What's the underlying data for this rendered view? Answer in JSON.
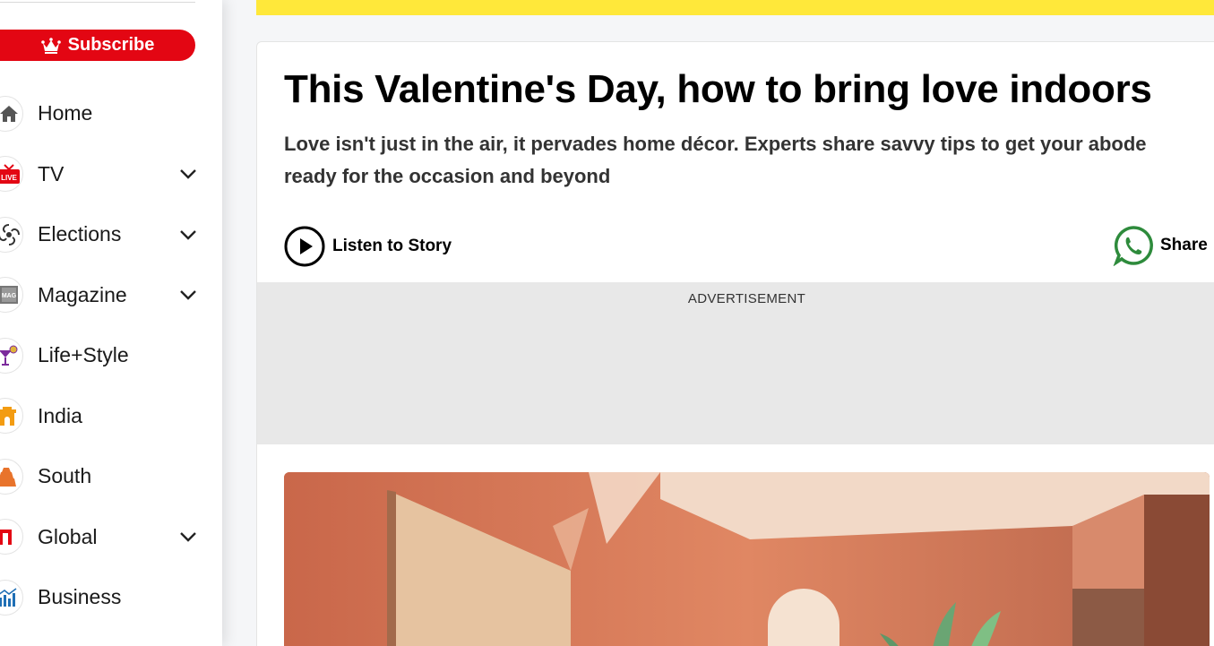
{
  "sidebar": {
    "subscribe_label": "Subscribe",
    "items": [
      {
        "label": "Home",
        "icon": "home-icon",
        "has_submenu": false
      },
      {
        "label": "TV",
        "icon": "live-tv-icon",
        "has_submenu": true
      },
      {
        "label": "Elections",
        "icon": "election-icon",
        "has_submenu": true
      },
      {
        "label": "Magazine",
        "icon": "magazine-icon",
        "has_submenu": true
      },
      {
        "label": "Life+Style",
        "icon": "cocktail-icon",
        "has_submenu": false
      },
      {
        "label": "India",
        "icon": "india-gate-icon",
        "has_submenu": false
      },
      {
        "label": "South",
        "icon": "temple-icon",
        "has_submenu": false
      },
      {
        "label": "Global",
        "icon": "global-icon",
        "has_submenu": true
      },
      {
        "label": "Business",
        "icon": "business-chart-icon",
        "has_submenu": false
      }
    ],
    "live_badge": "LIVE",
    "mag_badge": "MAG"
  },
  "article": {
    "headline": "This Valentine's Day, how to bring love indoors",
    "subheadline": "Love isn't just in the air, it pervades home décor. Experts share savvy tips to get your abode ready for the occasion and beyond",
    "listen_label": "Listen to Story",
    "share_label": "Share",
    "ad_label": "ADVERTISEMENT"
  },
  "colors": {
    "brand_red": "#e30613",
    "banner_yellow": "#ffe83a",
    "whatsapp_green": "#2e8b3c"
  }
}
